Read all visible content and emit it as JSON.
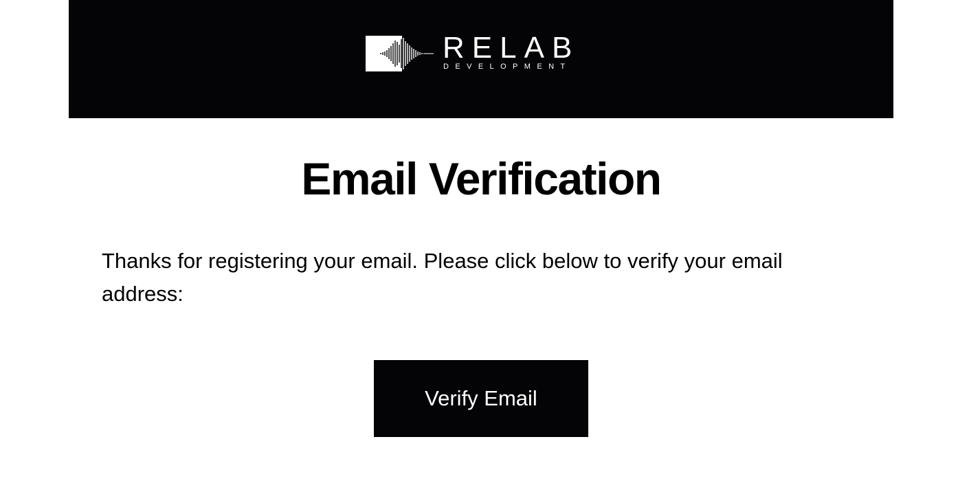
{
  "brand": {
    "name": "RELAB",
    "tagline": "DEVELOPMENT",
    "colors": {
      "header_background": "#040407",
      "logo": "#ffffff"
    }
  },
  "main": {
    "title": "Email Verification",
    "message": "Thanks for registering your email. Please click below to verify your email address:",
    "button": {
      "label": "Verify Email",
      "background": "#040407",
      "text_color": "#ffffff"
    }
  }
}
